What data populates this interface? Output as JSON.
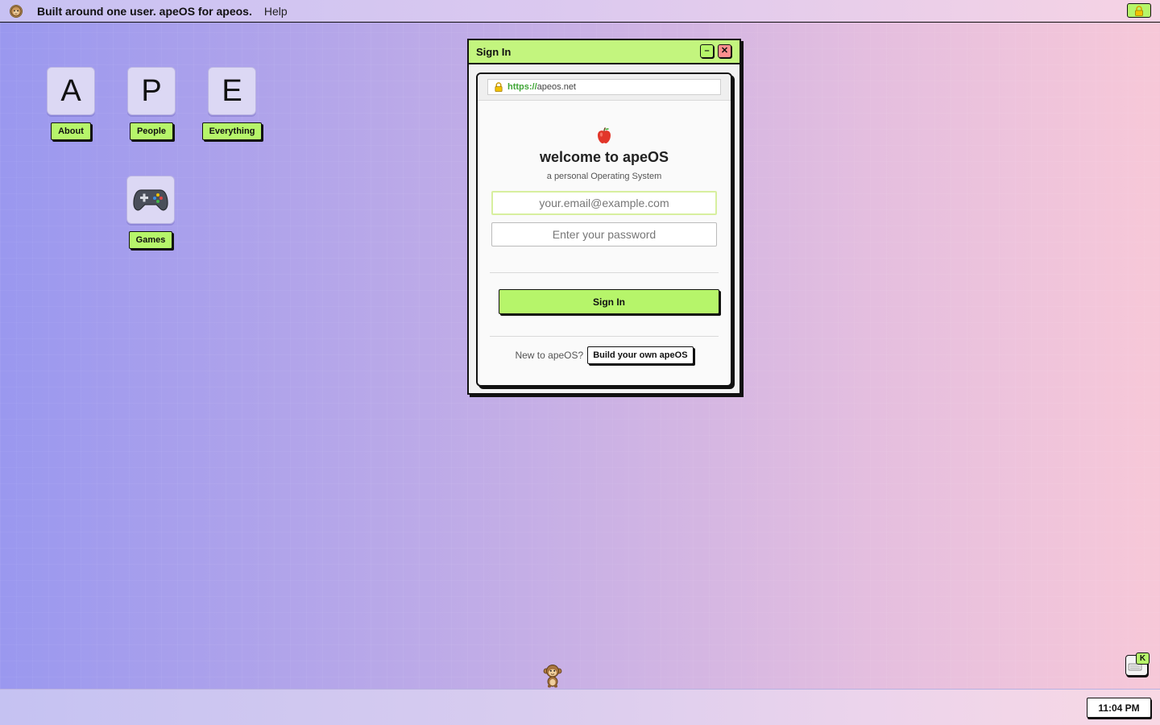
{
  "menubar": {
    "logo_icon": "monkey-icon",
    "title": "Built around one user. apeOS for apeos.",
    "help_label": "Help",
    "lock_icon": "lock-icon",
    "accent_color": "#b6f56a"
  },
  "desktop_icons": [
    {
      "letter": "A",
      "label": "About"
    },
    {
      "letter": "P",
      "label": "People"
    },
    {
      "letter": "E",
      "label": "Everything"
    },
    {
      "icon": "gamepad-icon",
      "label": "Games"
    }
  ],
  "window": {
    "title": "Sign In",
    "minimize_label": "–",
    "close_label": "✕",
    "browser": {
      "url_scheme": "https://",
      "url_host": "apeos.net"
    },
    "signin": {
      "icon": "apple-icon",
      "heading": "welcome to apeOS",
      "subtitle": "a personal Operating System",
      "email_placeholder": "your.email@example.com",
      "password_placeholder": "Enter your password",
      "submit_label": "Sign In",
      "new_prompt": "New to apeOS?",
      "build_label": "Build your own apeOS"
    }
  },
  "dock": {
    "mascot_icon": "monkey-icon",
    "keyboard_badge": "K"
  },
  "taskbar": {
    "clock": "11:04 PM"
  }
}
